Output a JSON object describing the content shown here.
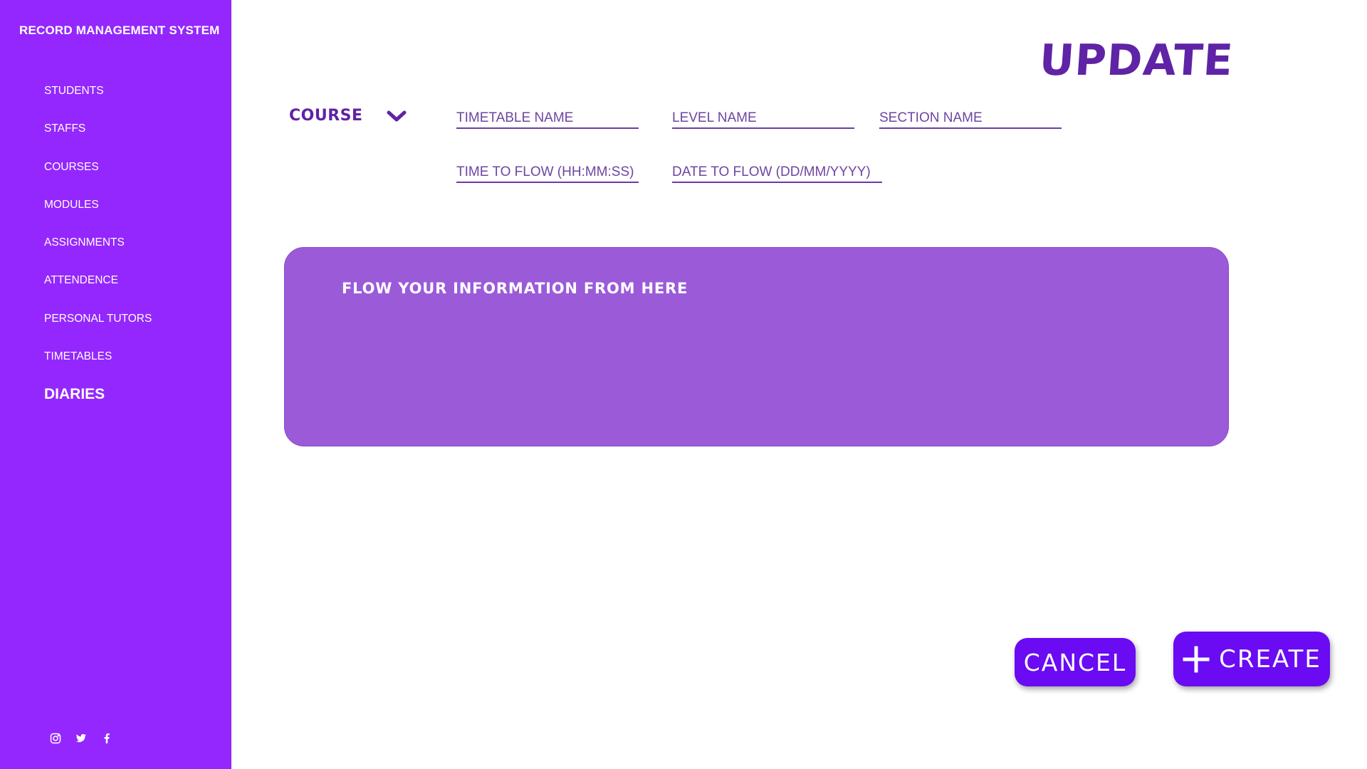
{
  "sidebar": {
    "brand": "RECORD MANAGEMENT SYSTEM",
    "items": [
      {
        "label": "STUDENTS"
      },
      {
        "label": "STAFFS"
      },
      {
        "label": "COURSES"
      },
      {
        "label": "MODULES"
      },
      {
        "label": "ASSIGNMENTS"
      },
      {
        "label": "ATTENDENCE"
      },
      {
        "label": "PERSONAL TUTORS"
      },
      {
        "label": "TIMETABLES"
      },
      {
        "label": "DIARIES"
      }
    ],
    "active_item": "DIARIES",
    "social": [
      "instagram-icon",
      "twitter-icon",
      "facebook-icon"
    ]
  },
  "header": {
    "title": "UPDATE"
  },
  "form": {
    "course_select": {
      "label": "COURSE",
      "icon": "chevron-down-icon"
    },
    "fields": {
      "timetable_name": "TIMETABLE NAME",
      "level_name": "LEVEL NAME",
      "section_name": "SECTION NAME",
      "time_to_flow": "TIME TO FLOW (HH:MM:SS)",
      "date_to_flow": "DATE TO FLOW (DD/MM/YYYY)"
    },
    "info_placeholder": "FLOW YOUR INFORMATION FROM HERE"
  },
  "actions": {
    "cancel_label": "CANCEL",
    "create_label": "CREATE"
  },
  "colors": {
    "sidebar": "#9427fd",
    "accent": "#5f23a5",
    "panel": "#9b5bd9",
    "button": "#6a0bf3"
  }
}
